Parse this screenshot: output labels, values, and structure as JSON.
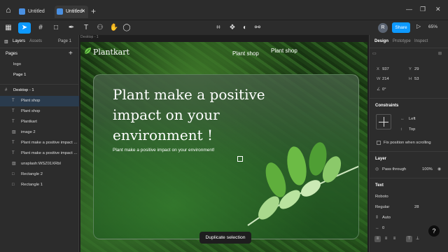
{
  "tabs": [
    {
      "label": "Untitled",
      "active": false
    },
    {
      "label": "Untitled",
      "active": true
    }
  ],
  "toolbar": {
    "avatar_initial": "R",
    "share_label": "Share",
    "zoom": "65%"
  },
  "left_panel": {
    "tabs": [
      "Layers",
      "Assets"
    ],
    "page_selector": "Page 1",
    "pages_title": "Pages",
    "pages": [
      "logo",
      "Page 1"
    ],
    "frame_name": "Desktop - 1",
    "layers": [
      {
        "icon": "T",
        "label": "Plant shop",
        "selected": true
      },
      {
        "icon": "T",
        "label": "Plant shop",
        "selected": false
      },
      {
        "icon": "T",
        "label": "Plantkart",
        "selected": false
      },
      {
        "icon": "▨",
        "label": "image 2",
        "selected": false
      },
      {
        "icon": "T",
        "label": "Plant make a positive impact ...",
        "selected": false
      },
      {
        "icon": "T",
        "label": "Plant make a positive impact ...",
        "selected": false
      },
      {
        "icon": "▨",
        "label": "unsplash:WSZ01XRbI",
        "selected": false
      },
      {
        "icon": "□",
        "label": "Rectangle 2",
        "selected": false
      },
      {
        "icon": "□",
        "label": "Rectangle 1",
        "selected": false
      }
    ]
  },
  "canvas": {
    "frame_label": "Desktop - 1",
    "logo": "Plantkart",
    "nav": [
      "Plant shop",
      "Plant shop"
    ],
    "headline": "Plant make a positive impact on your environment !",
    "subheadline": "Plant make a positive impact on your environment!",
    "duplicate_toast": "Duplicate selection"
  },
  "right_panel": {
    "tabs": [
      "Design",
      "Prototype",
      "Inspect"
    ],
    "x": {
      "label": "X",
      "value": "937"
    },
    "y": {
      "label": "Y",
      "value": "29"
    },
    "w": {
      "label": "W",
      "value": "214"
    },
    "h": {
      "label": "H",
      "value": "53"
    },
    "rotation": "0°",
    "constraints_title": "Constraints",
    "horizontal": "Left",
    "vertical": "Top",
    "fix_position": "Fix position when scrolling",
    "layer_title": "Layer",
    "blend": "Pass through",
    "opacity": "100%",
    "text_title": "Text",
    "font_family": "Roboto",
    "font_style": "Regular",
    "font_size": "28",
    "line_height": "Auto",
    "letter_spacing": "0"
  },
  "colors": {
    "accent": "#0d99ff",
    "panel_bg": "#2c2c2c",
    "canvas_bg": "#1e1e1e"
  }
}
